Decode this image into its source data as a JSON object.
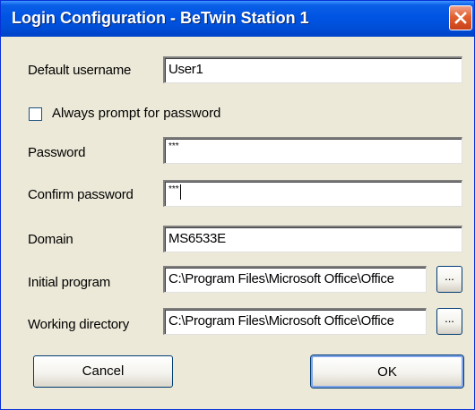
{
  "window": {
    "title": "Login Configuration - BeTwin Station 1"
  },
  "form": {
    "default_username": {
      "label": "Default username",
      "value": "User1"
    },
    "always_prompt": {
      "label": "Always prompt for password",
      "checked": false
    },
    "password": {
      "label": "Password",
      "value": "***"
    },
    "confirm_password": {
      "label": "Confirm password",
      "value": "***"
    },
    "domain": {
      "label": "Domain",
      "value": "MS6533E"
    },
    "initial_program": {
      "label": "Initial program",
      "value": "C:\\Program Files\\Microsoft Office\\Office",
      "browse_label": "..."
    },
    "working_directory": {
      "label": "Working directory",
      "value": "C:\\Program Files\\Microsoft Office\\Office",
      "browse_label": "..."
    }
  },
  "buttons": {
    "cancel_label": "Cancel",
    "ok_label": "OK"
  },
  "icons": {
    "close": "close-icon"
  },
  "colors": {
    "titlebar": "#0054e3",
    "close_button": "#e2602f",
    "dialog_background": "#ece9d8"
  }
}
